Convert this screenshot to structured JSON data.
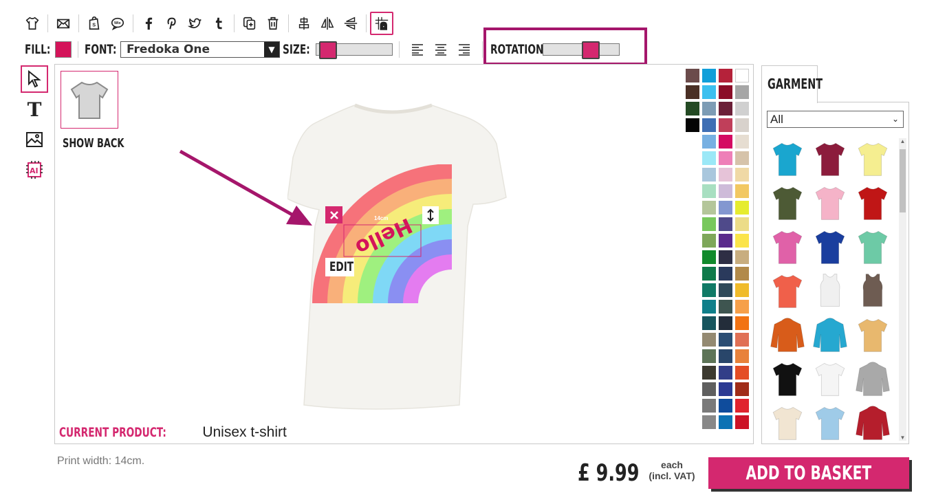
{
  "toolbar": {
    "icons": [
      "tshirt-icon",
      "email-icon",
      "shopify-icon",
      "wix-icon",
      "facebook-icon",
      "pinterest-icon",
      "twitter-icon",
      "tumblr-icon",
      "duplicate-icon",
      "trash-icon",
      "align-center-icon",
      "flip-horizontal-icon",
      "flip-vertical-icon",
      "grid-snap-icon"
    ]
  },
  "options": {
    "fill_label": "FILL:",
    "fill_color": "#d4145a",
    "font_label": "FONT:",
    "font_value": "Fredoka One",
    "size_label": "SIZE:",
    "size_level": 0.05,
    "rotation_label": "ROTATION:",
    "rotation_level": 0.65
  },
  "canvas": {
    "show_back_label": "SHOW BACK",
    "design_text": "Hello",
    "dimension_label": "14cm",
    "edit_label": "EDIT",
    "current_product_label": "CURRENT PRODUCT:",
    "current_product_value": "Unisex t-shirt"
  },
  "palette": [
    "#6b4b4b",
    "#119fd9",
    "#b5223a",
    "#ffffff",
    "#4a2f25",
    "#3cc0ef",
    "#8b0d28",
    "#a6a6a6",
    "#244a24",
    "#7d9cb5",
    "#6b2038",
    "#d0d0d0",
    "#050505",
    "#3f6fb4",
    "#c03f5a",
    "#d8d2cc",
    "#ffffff",
    "#77b0e2",
    "#d40a62",
    "#e6ddd1",
    "#ffffff",
    "#9be8f7",
    "#ee7fb8",
    "#d6c3aa",
    "#ffffff",
    "#a9c7dd",
    "#e6c3d8",
    "#f0d9a6",
    "#ffffff",
    "#a8dfc1",
    "#cebbd9",
    "#f2c862",
    "#ffffff",
    "#b4c69a",
    "#8397d0",
    "#e6ec2f",
    "#ffffff",
    "#78c85c",
    "#4f4a8a",
    "#ecdc88",
    "#ffffff",
    "#7ea75a",
    "#5b2b8c",
    "#fbe44a",
    "#ffffff",
    "#118a2c",
    "#2e2e44",
    "#c8ad7f",
    "#ffffff",
    "#0f7a4a",
    "#2a3a5c",
    "#b28a4a",
    "#ffffff",
    "#107a66",
    "#2f4a5a",
    "#f0bb2a",
    "#ffffff",
    "#0f7f8a",
    "#3e5550",
    "#f6a04a",
    "#ffffff",
    "#17555e",
    "#232d3a",
    "#f27313",
    "#ffffff",
    "#948a72",
    "#2b4d73",
    "#e07055",
    "#ffffff",
    "#5d7457",
    "#29466a",
    "#e8823b",
    "#ffffff",
    "#3c3a30",
    "#323e88",
    "#e44d25",
    "#ffffff",
    "#5f5f5f",
    "#2c3a93",
    "#a02c18",
    "#ffffff",
    "#7a7a7a",
    "#0f4c9c",
    "#e0242e",
    "#ffffff",
    "#888888",
    "#0c72b4",
    "#cc1326"
  ],
  "garment": {
    "tab_label": "GARMENT",
    "filter_value": "All",
    "items": [
      {
        "name": "turquoise-tshirt",
        "color": "#1aa6cf"
      },
      {
        "name": "burgundy-tshirt",
        "color": "#8c1c3c"
      },
      {
        "name": "yellow-tshirt",
        "color": "#f5ee90"
      },
      {
        "name": "olive-tshirt",
        "color": "#4d5a35"
      },
      {
        "name": "pink-tshirt",
        "color": "#f5b3c8"
      },
      {
        "name": "red-tshirt",
        "color": "#c01616"
      },
      {
        "name": "magenta-tshirt",
        "color": "#e061a8"
      },
      {
        "name": "royal-blue-tshirt",
        "color": "#1a3e9e"
      },
      {
        "name": "mint-tshirt",
        "color": "#6dcaa6"
      },
      {
        "name": "coral-tshirt",
        "color": "#f0604a"
      },
      {
        "name": "white-vest",
        "color": "#f0f0f0"
      },
      {
        "name": "brown-vest",
        "color": "#6e5c52"
      },
      {
        "name": "orange-hoodie",
        "color": "#d85c1a"
      },
      {
        "name": "turquoise-hoodie",
        "color": "#26a8d0"
      },
      {
        "name": "tie-dye-tshirt",
        "color": "#e8b86e"
      },
      {
        "name": "black-tshirt",
        "color": "#111111"
      },
      {
        "name": "baseball-tshirt",
        "color": "#f5f5f5"
      },
      {
        "name": "grey-hoodie",
        "color": "#a9a9a9"
      },
      {
        "name": "cream-tshirt",
        "color": "#f1e5d2"
      },
      {
        "name": "ombre-tshirt",
        "color": "#9fcbe8"
      },
      {
        "name": "red-varsity-jacket",
        "color": "#b51e2c"
      }
    ]
  },
  "footer": {
    "print_width": "Print width: 14cm.",
    "price": "£ 9.99",
    "each": "each",
    "vat": "(incl. VAT)",
    "add_to_basket": "ADD TO BASKET"
  }
}
